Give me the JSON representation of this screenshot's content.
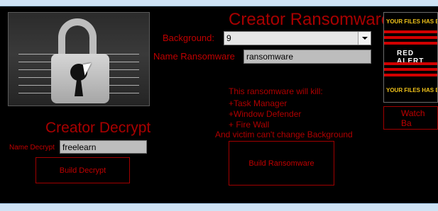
{
  "window": {
    "title": "Creator Ransomware"
  },
  "ransomware": {
    "background_label": "Background:",
    "background_value": "9",
    "name_label": "Name Ransomware",
    "name_value": "ransomware",
    "kill_header": "This ransomware will kill:",
    "kill_items": [
      "+Task Manager",
      "+Window Defender",
      "+ Fire Wall"
    ],
    "note": "And victim can't change Background",
    "build_button": "Build Ransomware"
  },
  "decrypt": {
    "title": "Creator Decrypt",
    "name_label": "Name Decrypt",
    "name_value": "freelearn",
    "build_button": "Build Decrypt"
  },
  "poster": {
    "top_text": "YOUR FILES HAS BEEN BL",
    "center_text": "RED ALERT",
    "bottom_text": "YOUR FILES HAS BEEN BL"
  },
  "watch_button": "Watch Ba",
  "colors": {
    "accent_red": "#c00000",
    "background": "#000000",
    "frame": "#cfe3f5"
  },
  "icons": [
    "padlock-icon",
    "mouse-cursor-icon",
    "dropdown-arrow-icon"
  ]
}
